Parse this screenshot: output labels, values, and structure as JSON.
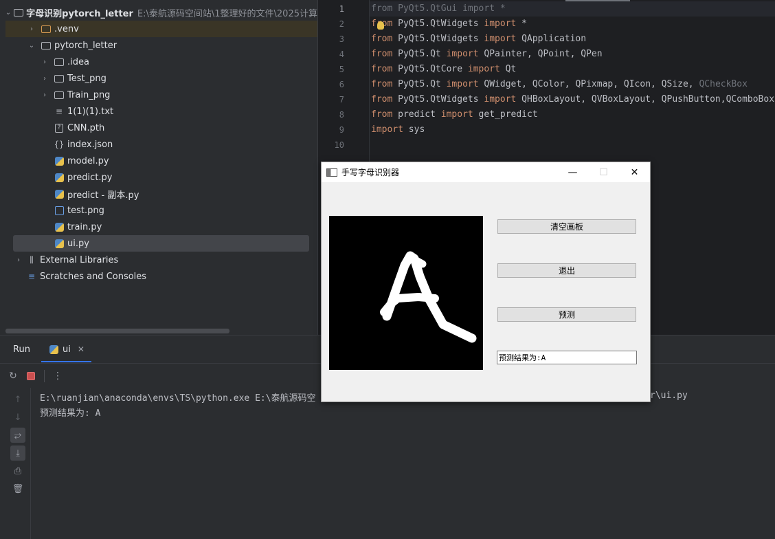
{
  "project": {
    "rows": [
      {
        "label": "字母识别pytorch_letter",
        "path": "E:\\泰航源码空间站\\1整理好的文件\\2025计算"
      },
      {
        "label": ".venv"
      },
      {
        "label": "pytorch_letter"
      },
      {
        "label": ".idea"
      },
      {
        "label": "Test_png"
      },
      {
        "label": "Train_png"
      },
      {
        "label": "1(1)(1).txt"
      },
      {
        "label": "CNN.pth"
      },
      {
        "label": "index.json"
      },
      {
        "label": "model.py"
      },
      {
        "label": "predict.py"
      },
      {
        "label": "predict - 副本.py"
      },
      {
        "label": "test.png"
      },
      {
        "label": "train.py"
      },
      {
        "label": "ui.py"
      },
      {
        "label": "External Libraries"
      },
      {
        "label": "Scratches and Consoles"
      }
    ]
  },
  "editor": {
    "line_numbers": [
      "1",
      "2",
      "3",
      "4",
      "5",
      "6",
      "7",
      "8",
      "9",
      "10"
    ],
    "lines": [
      {
        "kw1": "from",
        "mod": " PyQt5.QtGui ",
        "kw2": "import",
        "rest": " *"
      },
      {
        "kw1": "from",
        "mod": " PyQt5.QtWidgets ",
        "kw2": "import",
        "rest": " *"
      },
      {
        "kw1": "from",
        "mod": " PyQt5.QtWidgets ",
        "kw2": "import",
        "rest": " QApplication"
      },
      {
        "kw1": "from",
        "mod": " PyQt5.Qt ",
        "kw2": "import",
        "rest": " QPainter, QPoint, QPen"
      },
      {
        "kw1": "from",
        "mod": " PyQt5.QtCore ",
        "kw2": "import",
        "rest": " Qt"
      },
      {
        "kw1": "from",
        "mod": " PyQt5.Qt ",
        "kw2": "import",
        "rest": " QWidget, QColor, QPixmap, QIcon, QSize, ",
        "dim": "QCheckBox"
      },
      {
        "kw1": "from",
        "mod": " PyQt5.QtWidgets ",
        "kw2": "import",
        "rest": " QHBoxLayout, QVBoxLayout, QPushButton,QComboBox"
      },
      {
        "kw1": "from",
        "mod": " predict ",
        "kw2": "import",
        "rest": " get_predict"
      },
      {
        "kw1": "import",
        "mod": " sys",
        "kw2": "",
        "rest": ""
      }
    ]
  },
  "run": {
    "tab_run": "Run",
    "tab_ui": "ui",
    "console_line1_left": "E:\\ruanjian\\anaconda\\envs\\TS\\python.exe E:\\泰航源码空",
    "console_line1_right": "r\\ui.py",
    "console_line2": "预测结果为: A"
  },
  "qt": {
    "title": "手写字母识别器",
    "clear_button": "清空画板",
    "exit_button": "退出",
    "predict_button": "预测",
    "result_text": "预测结果为:A"
  }
}
